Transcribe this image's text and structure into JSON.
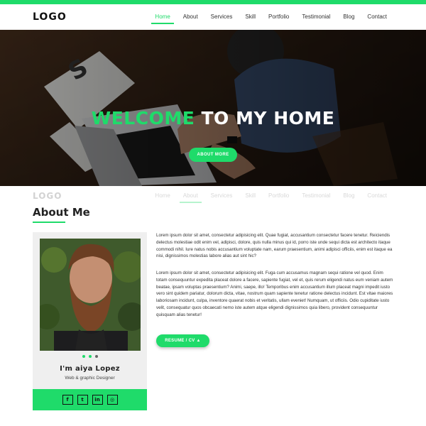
{
  "logo": "LOGO",
  "nav": {
    "items": [
      {
        "label": "Home",
        "active": true
      },
      {
        "label": "About",
        "active": false
      },
      {
        "label": "Services",
        "active": false
      },
      {
        "label": "Skill",
        "active": false
      },
      {
        "label": "Portfolio",
        "active": false
      },
      {
        "label": "Testimonial",
        "active": false
      },
      {
        "label": "Blog",
        "active": false
      },
      {
        "label": "Contact",
        "active": false
      }
    ]
  },
  "ghost_nav": {
    "logo": "LOGO",
    "items": [
      "Home",
      "About",
      "Services",
      "Skill",
      "Portfolio",
      "Testimonial",
      "Blog",
      "Contact"
    ]
  },
  "hero": {
    "title_accent": "WELCOME",
    "title_rest": " TO MY HOME",
    "button_label": "ABOUT MORE"
  },
  "about": {
    "title": "About Me",
    "name": "I'm aiya Lopez",
    "role": "Web & graphic Designer",
    "paragraph1": "Lorem ipsum dolor sit amet, consectetur adipisicing elit. Quae fugiat, accusantium consectetur facere tenetur. Reiciendis delectus molestiae odit enim vel, adipisci, dolore, quis nulla minus qui id, porro iste unde sequi dicta est architecto itaque commodi nihil. Iure natus nobis accusantium voluptate nam, earum praesentium, animi adipisci officiis, enim est itaque ea nisi, dignissimos molestias labore alias aut sint hic?",
    "paragraph2": "Lorem ipsum dolor sit amet, consectetur adipisicing elit. Fuga cum accusamus magnam sequi ratione vel quod. Enim totam consequuntur expedita placeat dolore a facere, sapiente fugiat, vel et, quis rerum eligendi natus eum veniam autem beatae, ipsam voluptas praesentium? Animi, saepe, illo! Temporibus enim accusantium illum placeat magni impedit iusto vero sint quidem pariatur, dolorum dicta, vitae, nostrum quam sapiente tenetur ratione delectus incidunt. Est vitae maiores laboriosam incidunt, culpa, inventore quaerat nobis et veritatis, ullam eveniet! Numquam, ut officiis. Odio cupiditate iusto velit, consequatur quos obcaecati nemo iste autem atque eligendi dignissimos quia libero, provident consequuntur quisquam alias tenetur!",
    "resume_label": "RESUME / CV",
    "resume_icon": "download-icon",
    "social": [
      {
        "icon": "facebook-icon",
        "glyph": "f"
      },
      {
        "icon": "twitter-icon",
        "glyph": "t"
      },
      {
        "icon": "linkedin-icon",
        "glyph": "in"
      },
      {
        "icon": "instagram-icon",
        "glyph": "◎"
      }
    ]
  },
  "colors": {
    "accent": "#1fdb6a",
    "text": "#222222",
    "card_bg": "#efefef"
  }
}
